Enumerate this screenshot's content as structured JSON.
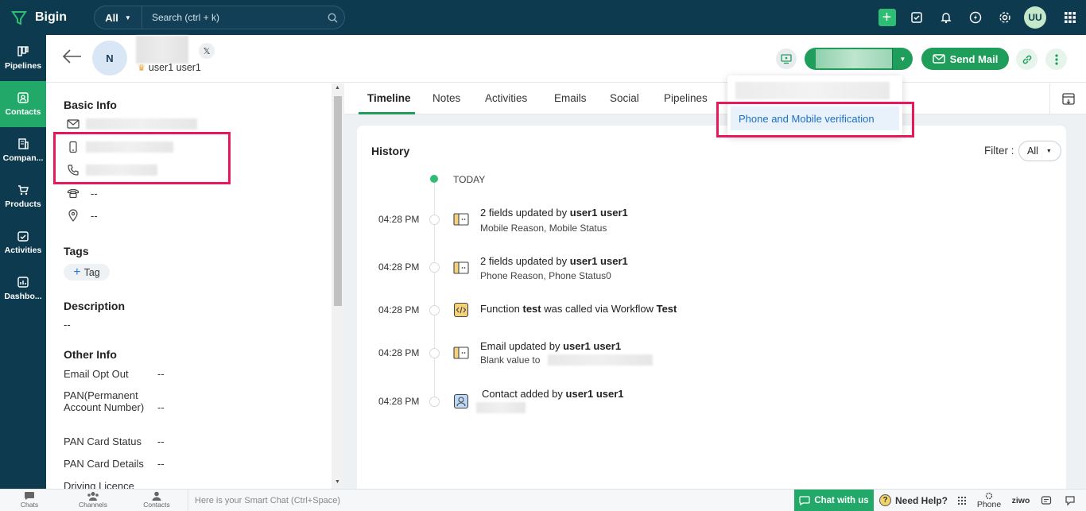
{
  "app": {
    "name": "Bigin"
  },
  "search": {
    "scope": "All",
    "placeholder": "Search (ctrl + k)"
  },
  "topbar": {
    "user_initials": "UU"
  },
  "nav": [
    {
      "label": "Pipelines",
      "icon": "pipelines-icon"
    },
    {
      "label": "Contacts",
      "icon": "contacts-icon",
      "active": true
    },
    {
      "label": "Compan...",
      "icon": "companies-icon"
    },
    {
      "label": "Products",
      "icon": "products-icon"
    },
    {
      "label": "Activities",
      "icon": "activities-icon"
    },
    {
      "label": "Dashbo...",
      "icon": "dashboards-icon"
    }
  ],
  "record": {
    "avatar_initial": "N",
    "social_badge": "𝕏",
    "owner": "user1 user1",
    "send_mail_label": "Send Mail"
  },
  "dropdown": {
    "item": "Phone and Mobile verification"
  },
  "left_panel": {
    "basic_info_title": "Basic Info",
    "home_phone": "--",
    "address": "--",
    "tags_title": "Tags",
    "tag_button": "Tag",
    "description_title": "Description",
    "description_value": "--",
    "other_info_title": "Other Info",
    "other_info": [
      {
        "label": "Email Opt Out",
        "value": "--"
      },
      {
        "label": "PAN(Permanent Account Number)",
        "value": "--"
      },
      {
        "label": "PAN Card Status",
        "value": "--"
      },
      {
        "label": "PAN Card Details",
        "value": "--"
      },
      {
        "label": "Driving Licence",
        "value": ""
      }
    ]
  },
  "tabs": [
    "Timeline",
    "Notes",
    "Activities",
    "Emails",
    "Social",
    "Pipelines"
  ],
  "history": {
    "title": "History",
    "filter_label": "Filter :",
    "filter_value": "All",
    "today_label": "TODAY",
    "entries": [
      {
        "time": "04:28 PM",
        "pre": "2 fields updated by ",
        "bold": "user1 user1",
        "post": "",
        "sub": "Mobile Reason, Mobile Status"
      },
      {
        "time": "04:28 PM",
        "pre": "2 fields updated by ",
        "bold": "user1 user1",
        "post": "",
        "sub": "Phone Reason, Phone Status0"
      },
      {
        "time": "04:28 PM",
        "pre": "Function ",
        "bold": "test",
        "post": " was called via Workflow ",
        "bold2": "Test",
        "sub": ""
      },
      {
        "time": "04:28 PM",
        "pre": "Email updated by ",
        "bold": "user1 user1",
        "post": "",
        "sub": "Blank value to"
      },
      {
        "time": "04:28 PM",
        "pre": "Contact added by ",
        "bold": "user1 user1",
        "post": "",
        "sub": ""
      }
    ]
  },
  "bottombar": {
    "chats": "Chats",
    "channels": "Channels",
    "contacts": "Contacts",
    "smartchat_placeholder": "Here is your Smart Chat (Ctrl+Space)",
    "chat_with_us": "Chat with us",
    "need_help": "Need Help?",
    "phone": "Phone",
    "ziwo": "ziwo"
  },
  "colors": {
    "brand_dark": "#0e3a4f",
    "brand_green": "#1f9d5a",
    "highlight_red": "#e8185a",
    "link_blue": "#1d6fc4"
  }
}
